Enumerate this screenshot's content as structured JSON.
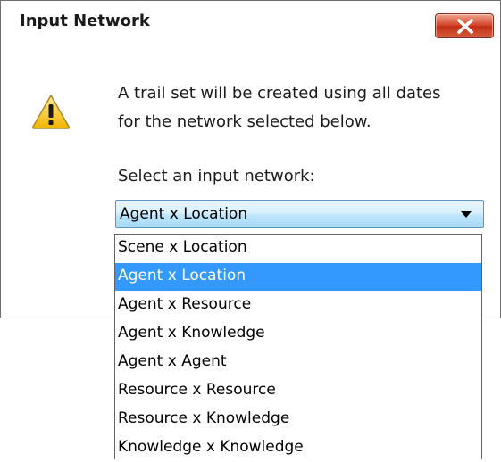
{
  "dialog": {
    "title": "Input Network",
    "message_line1": "A trail set will be created using all dates",
    "message_line2": "for the network selected below.",
    "select_label": "Select an input network:"
  },
  "icons": {
    "close": "close-x-icon",
    "warning": "warning-icon",
    "dropdown": "chevron-down-icon"
  },
  "combo": {
    "selected_value": "Agent x Location",
    "options": [
      "Scene x Location",
      "Agent x Location",
      "Agent x Resource",
      "Agent x Knowledge",
      "Agent x Agent",
      "Resource x Resource",
      "Resource x Knowledge",
      "Knowledge x Knowledge"
    ],
    "highlighted_index": 1
  },
  "colors": {
    "highlight": "#3399ff",
    "close_button": "#c7391d",
    "combo_border": "#5a96c8"
  }
}
